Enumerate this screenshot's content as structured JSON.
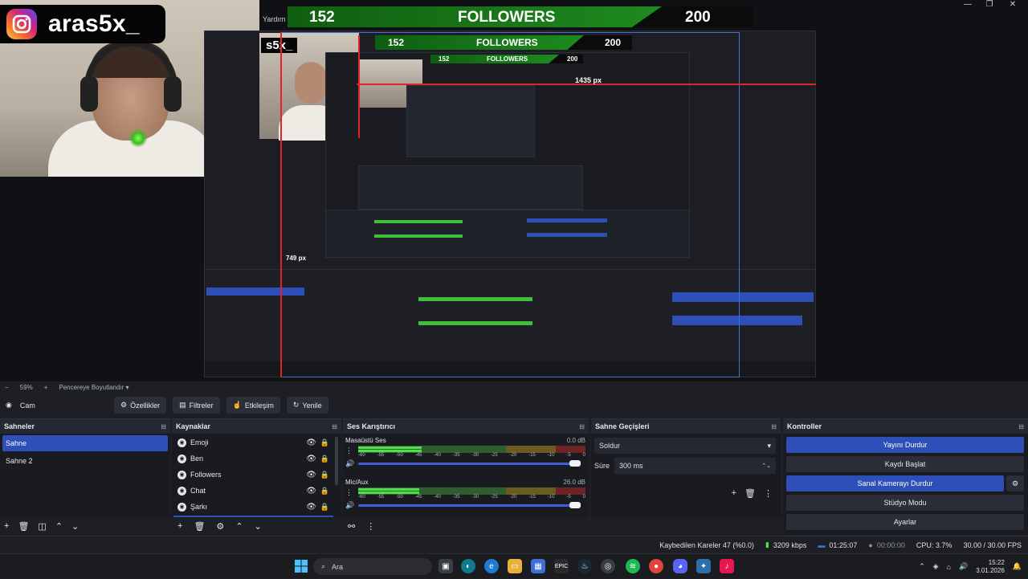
{
  "window": {
    "controls": [
      "—",
      "❐",
      "✕"
    ]
  },
  "overlay": {
    "instagram_handle": "aras5x_",
    "followers": {
      "yardim": "Yardım",
      "current": "152",
      "label": "FOLLOWERS",
      "goal": "200"
    },
    "nested_handle": "s5x_",
    "measure_h": "1435 px",
    "measure_v": "749 px"
  },
  "zoom": {
    "minus": "−",
    "value": "59%",
    "plus": "+",
    "fit_label": "Pencereye Boyutlandır"
  },
  "context": {
    "source_name": "Cam",
    "buttons": [
      {
        "label": "Özellikler",
        "icon": "gear-icon"
      },
      {
        "label": "Filtreler",
        "icon": "filter-icon"
      },
      {
        "label": "Etkileşim",
        "icon": "interact-icon"
      },
      {
        "label": "Yenile",
        "icon": "refresh-icon"
      }
    ]
  },
  "scenes": {
    "title": "Sahneler",
    "items": [
      "Sahne",
      "Sahne 2"
    ],
    "selected": "Sahne"
  },
  "sources": {
    "title": "Kaynaklar",
    "items": [
      "Emoji",
      "Ben",
      "Followers",
      "Chat",
      "Şarkı"
    ]
  },
  "mixer": {
    "title": "Ses Karıştırıcı",
    "scale": [
      "-60",
      "-55",
      "-50",
      "-45",
      "-40",
      "-35",
      "-30",
      "-25",
      "-20",
      "-15",
      "-10",
      "-5",
      "0"
    ],
    "channels": [
      {
        "name": "Masaüstü Ses",
        "db": "0.0 dB",
        "level": 0.28
      },
      {
        "name": "Mic/Aux",
        "db": "26.0 dB",
        "level": 0.27
      }
    ]
  },
  "transitions": {
    "title": "Sahne Geçişleri",
    "selected": "Soldur",
    "duration_label": "Süre",
    "duration_value": "300 ms"
  },
  "controls": {
    "title": "Kontroller",
    "buttons": [
      {
        "label": "Yayını Durdur",
        "active": true
      },
      {
        "label": "Kaydı Başlat",
        "active": false
      },
      {
        "label": "Sanal Kamerayı Durdur",
        "active": true
      },
      {
        "label": "Stüdyo Modu",
        "active": false
      },
      {
        "label": "Ayarlar",
        "active": false
      }
    ]
  },
  "status": {
    "dropped": "Kaybedilen Kareler 47 (%0.0)",
    "bitrate": "3209 kbps",
    "stream_time": "01:25:07",
    "rec_time": "00:00:00",
    "cpu": "CPU: 3.7%",
    "fps": "30.00 / 30.00 FPS"
  },
  "taskbar": {
    "search_placeholder": "Ara",
    "time": "15:22",
    "date": "3.01.2026"
  },
  "colors": {
    "accent": "#2f4fb8",
    "panel": "#1d1f25",
    "followers_green": "#1e8a1f",
    "guide_red": "#e3222a",
    "guide_blue": "#3f73d8"
  }
}
